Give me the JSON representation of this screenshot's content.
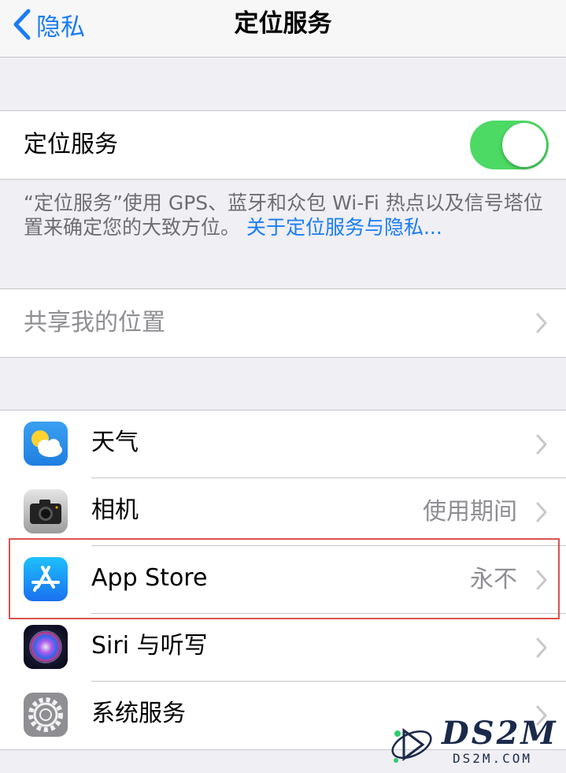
{
  "navbar": {
    "back_label": "隐私",
    "title": "定位服务"
  },
  "location_services": {
    "label": "定位服务",
    "enabled": true,
    "toggle_color": "#4cd964"
  },
  "footnote": {
    "text": "“定位服务”使用 GPS、蓝牙和众包 Wi-Fi 热点以及信号塔位置来确定您的大致方位。",
    "link": "关于定位服务与隐私..."
  },
  "share_location": {
    "label": "共享我的位置"
  },
  "apps": [
    {
      "name": "天气",
      "detail": "",
      "icon": "weather-icon"
    },
    {
      "name": "相机",
      "detail": "使用期间",
      "icon": "camera-icon"
    },
    {
      "name": "App Store",
      "detail": "永不",
      "icon": "app-store-icon"
    },
    {
      "name": "Siri 与听写",
      "detail": "",
      "icon": "siri-icon"
    },
    {
      "name": "系统服务",
      "detail": "",
      "icon": "settings-gear-icon"
    }
  ],
  "colors": {
    "accent": "#1a7cf5",
    "highlight_box": "#d9534f"
  },
  "watermark": {
    "logo": "DS2M",
    "domain": "DS2M.COM"
  }
}
